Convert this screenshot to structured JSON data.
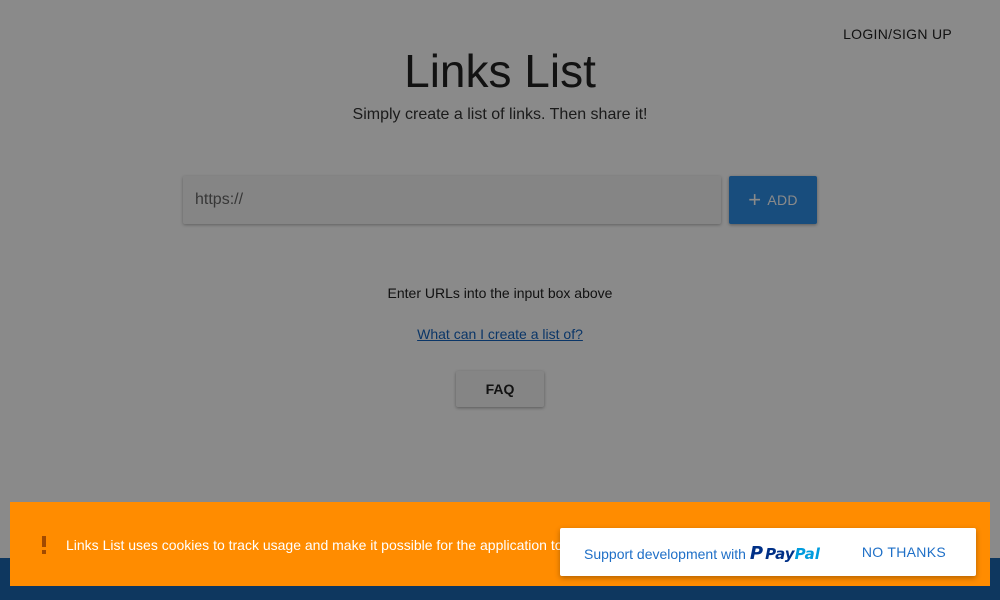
{
  "header": {
    "login_label": "LOGIN/SIGN UP"
  },
  "main": {
    "title": "Links List",
    "subtitle": "Simply create a list of links. Then share it!",
    "url_input": {
      "placeholder": "https://",
      "value": ""
    },
    "add_button": {
      "icon": "plus-icon",
      "label": "ADD"
    },
    "hint": "Enter URLs into the input box above",
    "help_link": "What can I create a list of?",
    "faq_label": "FAQ"
  },
  "cookie_banner": {
    "icon": "exclamation-icon",
    "text": "Links List uses cookies to track usage and make it possible for the application to"
  },
  "donation": {
    "support_text": "Support development with",
    "paypal_pay": "Pay",
    "paypal_pal": "Pal",
    "no_thanks_label": "NO THANKS"
  },
  "colors": {
    "primary": "#2d8fe8",
    "cookie_banner": "#ff8c00",
    "footer": "#1a66b0",
    "link": "#1565c0"
  }
}
